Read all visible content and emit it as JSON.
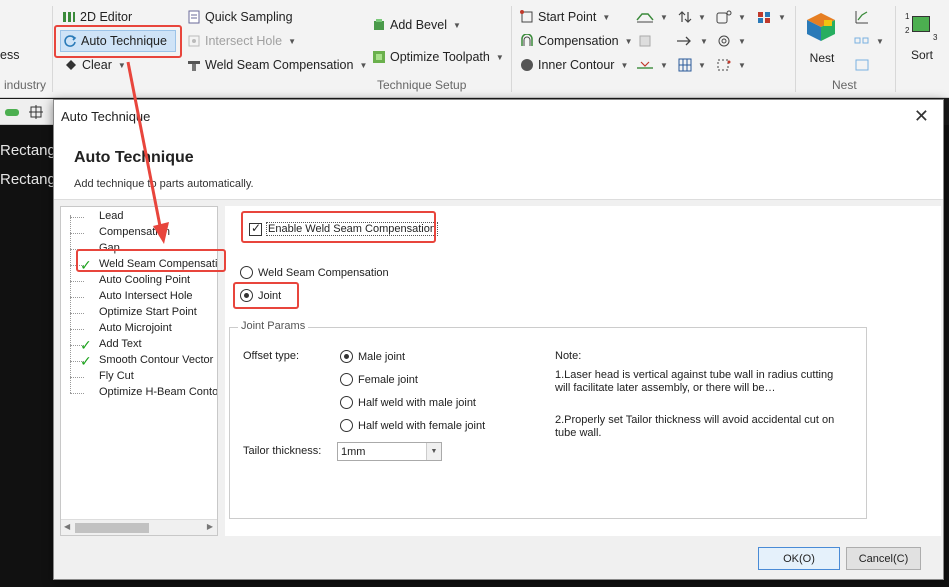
{
  "ribbon": {
    "left_label_partial": "ess",
    "group_industry_label": "industry",
    "editor_label": "2D Editor",
    "auto_technique_label": "Auto Technique",
    "clear_label": "Clear",
    "quick_sampling_label": "Quick Sampling",
    "intersect_hole_label": "Intersect Hole",
    "weld_seam_label": "Weld Seam Compensation",
    "add_bevel_label": "Add Bevel",
    "optimize_toolpath_label": "Optimize Toolpath",
    "start_point_label": "Start Point",
    "compensation_label": "Compensation",
    "inner_contour_label": "Inner Contour",
    "technique_setup_label": "Technique Setup",
    "nest_button_label": "Nest",
    "nest_group_label": "Nest",
    "sort_label": "Sort",
    "sort_num_1": "1",
    "sort_num_2": "2",
    "sort_num_3": "3"
  },
  "canvas": {
    "line1": "Rectang",
    "line2": "Rectang"
  },
  "dialog": {
    "title": "Auto Technique",
    "heading": "Auto Technique",
    "subtitle": "Add technique to parts automatically.",
    "tree": [
      {
        "label": "Lead",
        "checked": false
      },
      {
        "label": "Compensation",
        "checked": false
      },
      {
        "label": "Gap",
        "checked": false
      },
      {
        "label": "Weld Seam Compensation",
        "checked": true
      },
      {
        "label": "Auto Cooling Point",
        "checked": false
      },
      {
        "label": "Auto Intersect Hole",
        "checked": false
      },
      {
        "label": "Optimize Start Point",
        "checked": false
      },
      {
        "label": "Auto Microjoint",
        "checked": false
      },
      {
        "label": "Add Text",
        "checked": true
      },
      {
        "label": "Smooth Contour Vector",
        "checked": true
      },
      {
        "label": "Fly Cut",
        "checked": false
      },
      {
        "label": "Optimize H-Beam Contour",
        "checked": false
      }
    ],
    "enable_label": "Enable Weld Seam Compensation",
    "mode_options": [
      "Weld Seam Compensation",
      "Joint"
    ],
    "mode_selected": "Joint",
    "joint_params_legend": "Joint Params",
    "offset_type_label": "Offset type:",
    "offset_options": [
      "Male joint",
      "Female joint",
      "Half weld with male joint",
      "Half weld with female joint"
    ],
    "offset_selected": "Male joint",
    "tailor_label": "Tailor thickness:",
    "tailor_value": "1mm",
    "note_title": "Note:",
    "note_1": "1.Laser head is vertical against tube wall in radius cutting will facilitate later assembly, or there will be…",
    "note_2": "2.Properly set Tailor thickness will avoid accidental cut on tube wall.",
    "ok_label": "OK(O)",
    "cancel_label": "Cancel(C)"
  },
  "colors": {
    "highlight": "#e8453c",
    "check": "#19a219",
    "ok_border": "#4a8bd6"
  }
}
